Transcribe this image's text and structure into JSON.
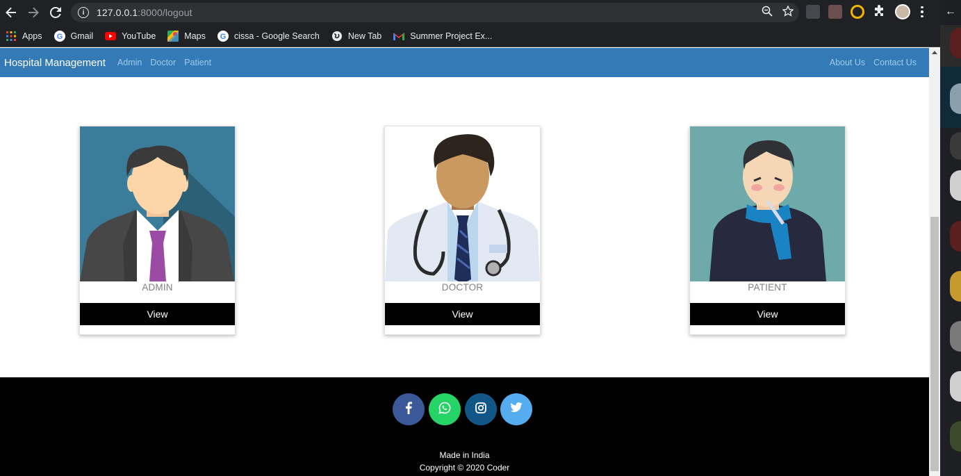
{
  "browser": {
    "url_host": "127.0.0.1",
    "url_path": ":8000/logout",
    "bookmarks": [
      {
        "label": "Apps",
        "icon": "apps-grid-icon"
      },
      {
        "label": "Gmail",
        "icon": "google-icon"
      },
      {
        "label": "YouTube",
        "icon": "youtube-icon"
      },
      {
        "label": "Maps",
        "icon": "maps-icon"
      },
      {
        "label": "cissa - Google Search",
        "icon": "google-icon"
      },
      {
        "label": "New Tab",
        "icon": "globe-icon"
      },
      {
        "label": "Summer Project Ex...",
        "icon": "gmail-icon"
      }
    ]
  },
  "navbar": {
    "brand": "Hospital Management",
    "left_links": [
      "Admin",
      "Doctor",
      "Patient"
    ],
    "right_links": [
      "About Us",
      "Contact Us"
    ],
    "color": "#337ab7"
  },
  "cards": [
    {
      "label": "ADMIN",
      "button": "View"
    },
    {
      "label": "DOCTOR",
      "button": "View"
    },
    {
      "label": "PATIENT",
      "button": "View"
    }
  ],
  "footer": {
    "social": [
      {
        "name": "facebook",
        "icon": "facebook-icon",
        "color": "#3b5998"
      },
      {
        "name": "whatsapp",
        "icon": "whatsapp-icon",
        "color": "#25d366"
      },
      {
        "name": "instagram",
        "icon": "instagram-icon",
        "color": "#125688"
      },
      {
        "name": "twitter",
        "icon": "twitter-icon",
        "color": "#55acee"
      }
    ],
    "made_in": "Made in India",
    "copyright": "Copyright © 2020 Coder"
  }
}
